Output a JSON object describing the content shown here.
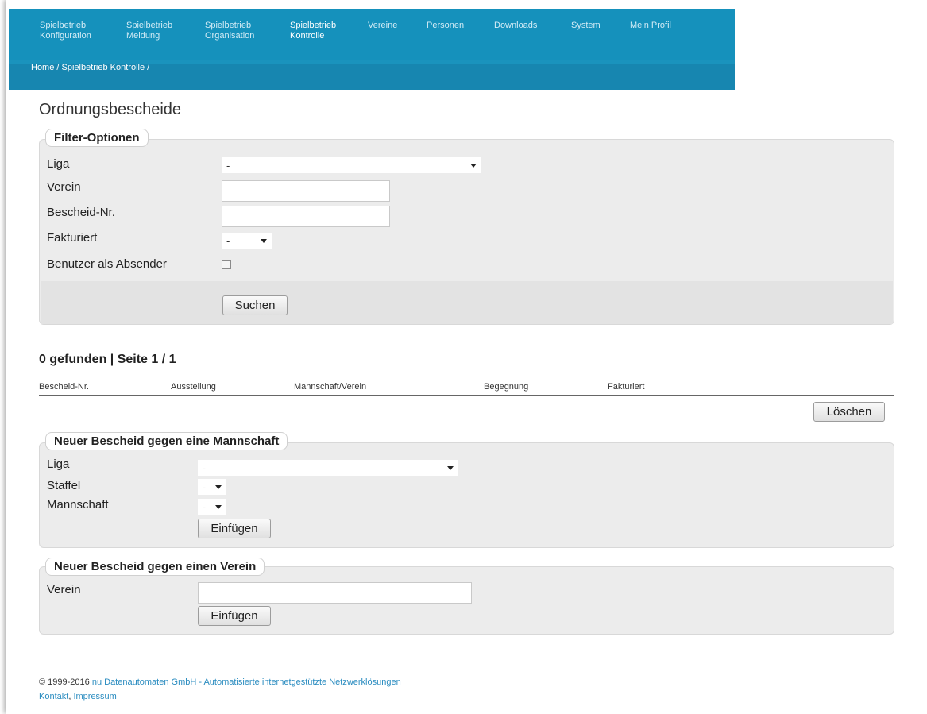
{
  "nav": {
    "items": [
      {
        "label": "Spielbetrieb\nKonfiguration",
        "active": false
      },
      {
        "label": "Spielbetrieb\nMeldung",
        "active": false
      },
      {
        "label": "Spielbetrieb\nOrganisation",
        "active": false
      },
      {
        "label": "Spielbetrieb\nKontrolle",
        "active": true
      },
      {
        "label": "Vereine",
        "active": false
      },
      {
        "label": "Personen",
        "active": false
      },
      {
        "label": "Downloads",
        "active": false
      },
      {
        "label": "System",
        "active": false
      },
      {
        "label": "Mein Profil",
        "active": false
      }
    ],
    "breadcrumb": "Home / Spielbetrieb Kontrolle /"
  },
  "page": {
    "title": "Ordnungsbescheide"
  },
  "filter": {
    "legend": "Filter-Optionen",
    "liga_label": "Liga",
    "liga_value": "-",
    "verein_label": "Verein",
    "verein_value": "",
    "bescheid_label": "Bescheid-Nr.",
    "bescheid_value": "",
    "fakturiert_label": "Fakturiert",
    "fakturiert_value": "-",
    "absender_label": "Benutzer als Absender",
    "absender_checked": false,
    "search_button": "Suchen"
  },
  "results": {
    "summary": "0 gefunden | Seite 1 / 1",
    "columns": [
      "Bescheid-Nr.",
      "Ausstellung",
      "Mannschaft/Verein",
      "Begegnung",
      "Fakturiert"
    ],
    "rows": [],
    "delete_button": "Löschen"
  },
  "new_team": {
    "legend": "Neuer Bescheid gegen eine Mannschaft",
    "liga_label": "Liga",
    "liga_value": "-",
    "staffel_label": "Staffel",
    "staffel_value": "-",
    "mannschaft_label": "Mannschaft",
    "mannschaft_value": "-",
    "insert_button": "Einfügen"
  },
  "new_club": {
    "legend": "Neuer Bescheid gegen einen Verein",
    "verein_label": "Verein",
    "verein_value": "",
    "insert_button": "Einfügen"
  },
  "footer": {
    "copyright": "© 1999-2016",
    "company_link": "nu Datenautomaten GmbH - Automatisierte internetgestützte Netzwerklösungen",
    "contact_link": "Kontakt",
    "separator": ",",
    "imprint_link": "Impressum"
  },
  "colors": {
    "nav_bg": "#1591bc",
    "breadcrumb_bg": "#1786b0",
    "fieldset_bg": "#ececec",
    "link": "#2a8cc0"
  }
}
